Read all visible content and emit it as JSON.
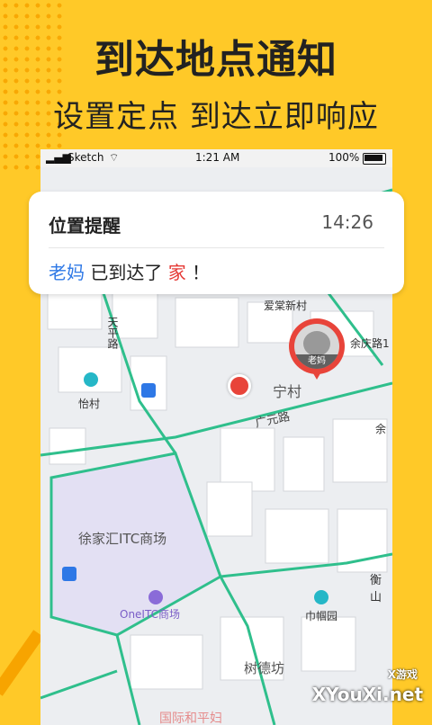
{
  "promo": {
    "title": "到达地点通知",
    "subtitle": "设置定点 到达立即响应"
  },
  "status_bar": {
    "carrier": "Sketch",
    "time": "1:21 AM",
    "battery": "100%"
  },
  "notification": {
    "title": "位置提醒",
    "time": "14:26",
    "person": "老妈",
    "action": "已到达了",
    "place": "家",
    "end": "！"
  },
  "map": {
    "labels": {
      "community": "爱棠新村",
      "yuqing_road": "余庆路1",
      "tianping_road": "天平路",
      "yicun": "怡村",
      "ningcun": "宁村",
      "guangyuan_road": "广元路",
      "yu": "余",
      "itc": "徐家汇ITC商场",
      "oneitc": "OneITC商场",
      "hengshan": "衡山",
      "jinguoyuan": "巾帼园",
      "shudefang": "树德坊",
      "bottom": "国际和平妇"
    },
    "avatar_label": "老妈"
  },
  "watermark": {
    "small": "X游戏",
    "big": "XYouXi.net"
  },
  "colors": {
    "background": "#FFC928",
    "road_green": "#2FBF8C",
    "itc_area": "#E3E0F3",
    "pin_red": "#E8443A",
    "name_blue": "#2E78E6"
  }
}
